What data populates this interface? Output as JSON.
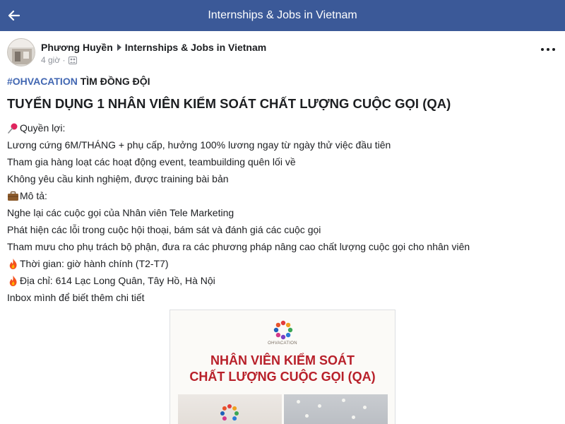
{
  "topbar": {
    "title": "Internships & Jobs in Vietnam",
    "back_icon": "arrow-left-icon",
    "color": "#3b5998"
  },
  "post": {
    "author": "Phương Huyền",
    "group": "Internships & Jobs in Vietnam",
    "time": "4 giờ ·",
    "privacy_icon": "group-members-icon",
    "more_icon": "more-options-icon",
    "hashtag": "#OHVACATION",
    "hashline_rest": " TÌM ĐỒNG ĐỘI",
    "title": "TUYỂN DỤNG 1 NHÂN VIÊN KIỂM SOÁT CHẤT LƯỢNG CUỘC GỌI (QA)",
    "lines": [
      {
        "icon": "pushpin-icon",
        "text": "Quyền lợi:"
      },
      {
        "icon": "",
        "text": "Lương cứng 6M/THÁNG + phụ cấp, hưởng 100% lương ngay từ ngày thử việc đầu tiên"
      },
      {
        "icon": "",
        "text": "Tham gia hàng loạt các hoạt động event, teambuilding quên lối về"
      },
      {
        "icon": "",
        "text": "Không yêu cầu kinh nghiệm, được training bài bản"
      },
      {
        "icon": "briefcase-icon",
        "text": "Mô tả:"
      },
      {
        "icon": "",
        "text": "Nghe lại các cuộc gọi của Nhân viên Tele Marketing"
      },
      {
        "icon": "",
        "text": "Phát hiện các lỗi trong cuộc hội thoại, bám sát và đánh giá các cuộc gọi"
      },
      {
        "icon": "",
        "text": "Tham mưu cho phụ trách bộ phận, đưa ra các phương pháp nâng cao chất lượng cuộc gọi cho nhân viên"
      },
      {
        "icon": "fire-icon",
        "text": "Thời gian: giờ hành chính (T2-T7)"
      },
      {
        "icon": "fire-icon",
        "text": "Địa chỉ: 614 Lạc Long Quân, Tây Hồ, Hà Nội"
      },
      {
        "icon": "",
        "text": "Inbox mình để biết thêm chi tiết"
      }
    ]
  },
  "image": {
    "logo_text": "OHVACATION",
    "headline_1": "NHÂN VIÊN KIỂM SOÁT",
    "headline_2": "CHẤT LƯỢNG CUỘC GỌI (QA)",
    "headline_color": "#b8202a"
  },
  "colors": {
    "hashtag": "#4267b2",
    "text": "#1c1e21",
    "meta": "#90949c"
  }
}
